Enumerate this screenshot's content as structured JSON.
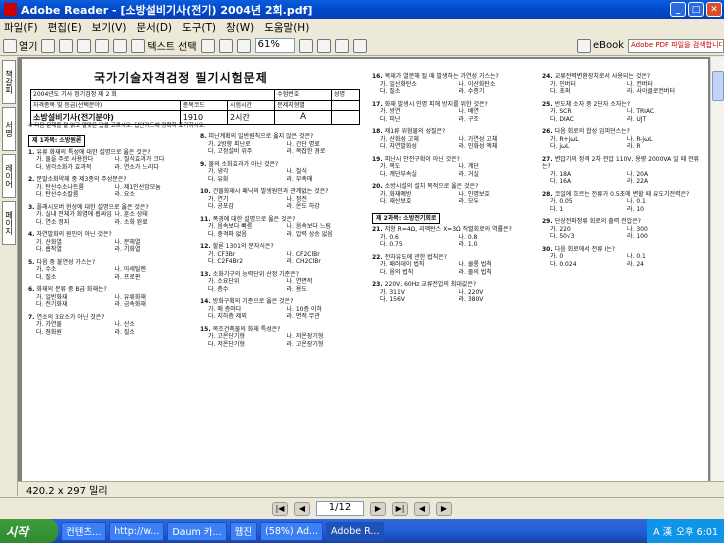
{
  "window": {
    "title": "Adobe Reader - [소방설비기사(전기) 2004년 2회.pdf]"
  },
  "menu": [
    "파일(F)",
    "편집(E)",
    "보기(V)",
    "문서(D)",
    "도구(T)",
    "창(W)",
    "도움말(H)"
  ],
  "toolbar": {
    "open_label": "열기",
    "text_select_label": "텍스트 선택",
    "zoom_value": "61%",
    "ebook_label": "eBook",
    "adobe_pdf_link": "Adobe PDF 파일을 검색합니다."
  },
  "side_tabs": [
    "책갈피",
    "서명",
    "레이어",
    "페이지"
  ],
  "page": {
    "title": "국가기술자격검정 필기시험문제",
    "table": {
      "row1": [
        "2004년도 기사 정기검정 제 2 회",
        "",
        "",
        "수험번호",
        "성명"
      ],
      "row2": [
        "자격종목 및 등급(선택분야)",
        "종목코드",
        "시험시간",
        "문제지형별",
        ""
      ],
      "row3": [
        "소방설비기사(전기분야)",
        "1910",
        "2시간",
        "A",
        ""
      ]
    },
    "notice": "※ 다음 문제를 잘 읽고 알맞은 답을 고르시오. 답안카드에 정확히 표기하시오.",
    "sec1": "제 1과목: 소방원론",
    "sec2": "제 2과목: 소방전기회로",
    "col1": [
      {
        "n": "1",
        "q": "유류 화재의 특성에 대한 설명으로 옳은 것은?",
        "o": [
          "가. 물을 주로 사용한다",
          "나. 질식효과가 크다",
          "다. 냉각소화가 효과적",
          "라. 연소가 느리다"
        ]
      },
      {
        "n": "2",
        "q": "분말소화약제 중 제3종의 주성분은?",
        "o": [
          "가. 탄산수소나트륨",
          "나. 제1인산암모늄",
          "다. 탄산수소칼륨",
          "라. 요소"
        ]
      },
      {
        "n": "3",
        "q": "플래시오버 현상에 대한 설명으로 옳은 것은?",
        "o": [
          "가. 실내 전체가 화염에 휩싸임",
          "나. 훈소 상태",
          "다. 연소 정지",
          "라. 소화 완료"
        ]
      },
      {
        "n": "4",
        "q": "자연발화의 원인이 아닌 것은?",
        "o": [
          "가. 산화열",
          "나. 분해열",
          "다. 흡착열",
          "라. 기화열"
        ]
      },
      {
        "n": "5",
        "q": "다음 중 불연성 가스는?",
        "o": [
          "가. 수소",
          "나. 아세틸렌",
          "다. 질소",
          "라. 프로판"
        ]
      },
      {
        "n": "6",
        "q": "화재의 분류 중 B급 화재는?",
        "o": [
          "가. 일반화재",
          "나. 유류화재",
          "다. 전기화재",
          "라. 금속화재"
        ]
      },
      {
        "n": "7",
        "q": "연소의 3요소가 아닌 것은?",
        "o": [
          "가. 가연물",
          "나. 산소",
          "다. 점화원",
          "라. 질소"
        ]
      }
    ],
    "col2": [
      {
        "n": "8",
        "q": "피난계획의 일반원칙으로 옳지 않은 것은?",
        "o": [
          "가. 2방향 피난로",
          "나. 간단 명료",
          "다. 고정설비 위주",
          "라. 복잡한 경로"
        ]
      },
      {
        "n": "9",
        "q": "물의 소화효과가 아닌 것은?",
        "o": [
          "가. 냉각",
          "나. 질식",
          "다. 유화",
          "라. 부촉매"
        ]
      },
      {
        "n": "10",
        "q": "건물화재시 패닉의 발생원인과 관계없는 것은?",
        "o": [
          "가. 연기",
          "나. 정전",
          "다. 공포감",
          "라. 온도 하강"
        ]
      },
      {
        "n": "11",
        "q": "폭굉에 대한 설명으로 옳은 것은?",
        "o": [
          "가. 음속보다 빠름",
          "나. 음속보다 느림",
          "다. 충격파 없음",
          "라. 압력 상승 없음"
        ]
      },
      {
        "n": "12",
        "q": "할론 1301의 분자식은?",
        "o": [
          "가. CF3Br",
          "나. CF2ClBr",
          "다. C2F4Br2",
          "라. CH2ClBr"
        ]
      },
      {
        "n": "13",
        "q": "소화기구의 능력단위 산정 기준은?",
        "o": [
          "가. 소요단위",
          "나. 연면적",
          "다. 층수",
          "라. 용도"
        ]
      },
      {
        "n": "14",
        "q": "방화구획의 기준으로 옳은 것은?",
        "o": [
          "가. 매 층마다",
          "나. 10층 이하",
          "다. 지하층 제외",
          "라. 면적 무관"
        ]
      },
      {
        "n": "15",
        "q": "목조건축물의 화재 특성은?",
        "o": [
          "가. 고온단기형",
          "나. 저온장기형",
          "다. 저온단기형",
          "라. 고온장기형"
        ]
      }
    ],
    "col3": [
      {
        "n": "16",
        "q": "목재가 열분해 될 때 발생하는 가연성 가스는?",
        "o": [
          "가. 일산화탄소",
          "나. 이산화탄소",
          "다. 질소",
          "라. 수증기"
        ]
      },
      {
        "n": "17",
        "q": "화재 발생시 인명 피해 방지를 위한 것은?",
        "o": [
          "가. 방연",
          "나. 배연",
          "다. 피난",
          "라. 구조"
        ]
      },
      {
        "n": "18",
        "q": "제1류 위험물의 성질은?",
        "o": [
          "가. 산화성 고체",
          "나. 가연성 고체",
          "다. 자연발화성",
          "라. 인화성 액체"
        ]
      },
      {
        "n": "19",
        "q": "피난시 안전구획이 아닌 것은?",
        "o": [
          "가. 복도",
          "나. 계단",
          "다. 계단부속실",
          "라. 거실"
        ]
      },
      {
        "n": "20",
        "q": "소방시설의 설치 목적으로 옳은 것은?",
        "o": [
          "가. 화재예방",
          "나. 인명보호",
          "다. 재산보호",
          "라. 모두"
        ]
      },
      {
        "n": "21",
        "q": "저항 R=4Ω, 리액턴스 X=3Ω 직렬회로의 역률은?",
        "o": [
          "가. 0.6",
          "나. 0.8",
          "다. 0.75",
          "라. 1.0"
        ]
      },
      {
        "n": "22",
        "q": "전자유도에 관한 법칙은?",
        "o": [
          "가. 패러데이 법칙",
          "나. 쿨롱 법칙",
          "다. 옴의 법칙",
          "라. 줄의 법칙"
        ]
      },
      {
        "n": "23",
        "q": "220V, 60Hz 교류전압의 최대값은?",
        "o": [
          "가. 311V",
          "나. 220V",
          "다. 156V",
          "라. 380V"
        ]
      }
    ],
    "col4": [
      {
        "n": "24",
        "q": "교류전력변환장치로서 사용되는 것은?",
        "o": [
          "가. 인버터",
          "나. 컨버터",
          "다. 초퍼",
          "라. 사이클로컨버터"
        ]
      },
      {
        "n": "25",
        "q": "반도체 소자 중 2단자 소자는?",
        "o": [
          "가. SCR",
          "나. TRIAC",
          "다. DIAC",
          "라. UJT"
        ]
      },
      {
        "n": "26",
        "q": "다음 회로의 합성 임피던스는?",
        "o": [
          "가. R+jωL",
          "나. R-jωL",
          "다. jωL",
          "라. R"
        ]
      },
      {
        "n": "27",
        "q": "변압기의 정격 2차 전압 110V, 용량 2000VA 일 때 전류는?",
        "o": [
          "가. 18A",
          "나. 20A",
          "다. 16A",
          "라. 22A"
        ]
      },
      {
        "n": "28",
        "q": "코일에 흐르는 전류가 0.5초에 변할 때 유도기전력은?",
        "o": [
          "가. 0.05",
          "나. 0.1",
          "다. 1",
          "라. 10"
        ]
      },
      {
        "n": "29",
        "q": "단상전파정류 회로의 출력 전압은?",
        "o": [
          "가. 220",
          "나. 300",
          "다. 50√3",
          "라. 100"
        ]
      },
      {
        "n": "30",
        "q": "다음 회로에서 전류 I는?",
        "o": [
          "가. 0",
          "나. 0.1",
          "다. 0.024",
          "라. 24"
        ]
      }
    ]
  },
  "status": {
    "page_size": "420.2 x 297 밀리"
  },
  "nav": {
    "page_value": "1/12"
  },
  "taskbar": {
    "start_label": "시작",
    "tasks": [
      "컨텐츠...",
      "http://w...",
      "Daum 카...",
      "웹진",
      "(58%) Ad...",
      "Adobe R...",
      "A 漢"
    ],
    "clock": "오후 6:01"
  }
}
